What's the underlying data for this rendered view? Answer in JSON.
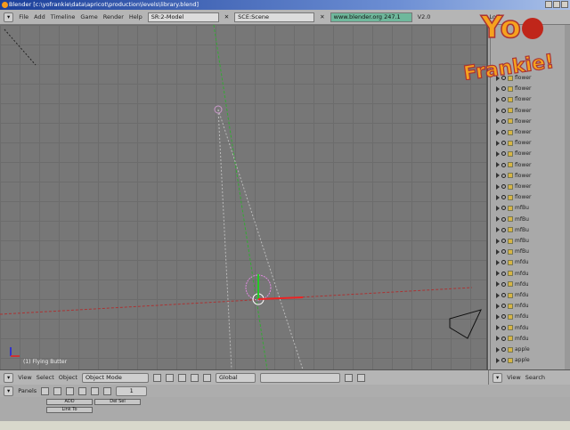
{
  "window": {
    "title": "Blender [c:\\yofrankie\\data\\apricot\\production\\levels\\library.blend]"
  },
  "topbar": {
    "menus": [
      "File",
      "Add",
      "Timeline",
      "Game",
      "Render",
      "Help"
    ],
    "screen": "SR:2-Model",
    "scene": "SCE:Scene",
    "version_info": "www.blender.org 247.1",
    "extra": [
      "V2.0",
      "Lod"
    ]
  },
  "logo": {
    "text": "Yo Frankie!"
  },
  "viewport": {
    "object_label": "(1) Flying Butter"
  },
  "outliner": {
    "items": [
      "flower",
      "flower",
      "flower",
      "flower",
      "flower",
      "flower",
      "flower",
      "flower",
      "flower",
      "flower",
      "flower",
      "flower",
      "mfBu",
      "mfBu",
      "mfBu",
      "mfBu",
      "mfBu",
      "mfdu",
      "mfdu",
      "mfdu",
      "mfdu",
      "mfdu",
      "mfdu",
      "mfdu",
      "mfdu",
      "apple",
      "apple"
    ]
  },
  "view3d_header": {
    "view": "View",
    "select": "Select",
    "object": "Object",
    "mode": "Object Mode",
    "orientation": "Global"
  },
  "outliner_header": {
    "view": "View",
    "search": "Search"
  },
  "buttons_header": {
    "panels": "Panels",
    "page": "1"
  },
  "buttons_panel": {
    "b1": "ADD",
    "b2": "Del Sel",
    "b3": "Link To"
  },
  "colors": {
    "titlebar": "#1b3f9a",
    "viewport": "#777777",
    "accent": "#f49a1c"
  }
}
